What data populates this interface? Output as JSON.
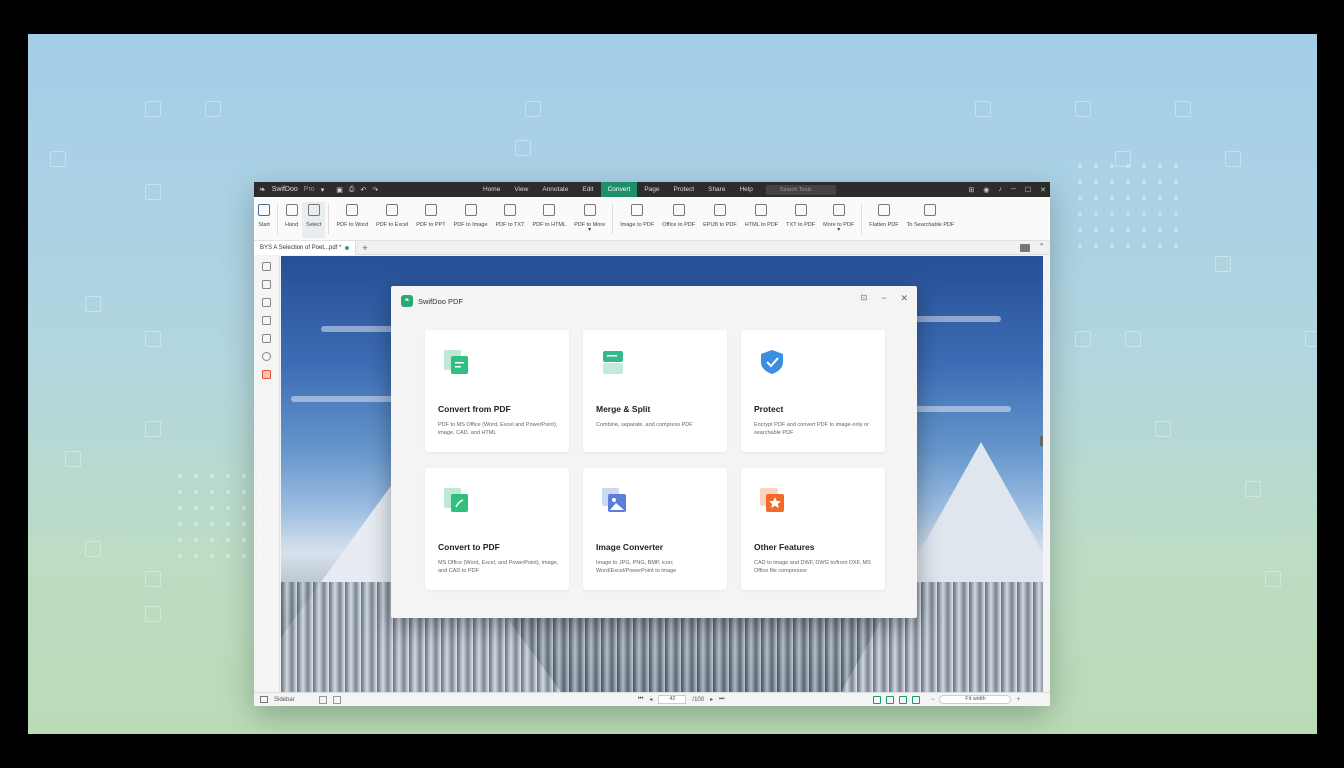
{
  "app": {
    "name": "SwifDoo",
    "edition": "Pro",
    "menu": [
      "Home",
      "View",
      "Annotate",
      "Edit",
      "Convert",
      "Page",
      "Protect",
      "Share",
      "Help"
    ],
    "active_menu": "Convert",
    "search_placeholder": "Search Tools"
  },
  "ribbon": {
    "start": "Start",
    "hand": "Hand",
    "select": "Select",
    "from_pdf": [
      "PDF to Word",
      "PDF to Excel",
      "PDF to PPT",
      "PDF to Image",
      "PDF to TXT",
      "PDF to HTML",
      "PDF to More"
    ],
    "to_pdf": [
      "Image to PDF",
      "Office to PDF",
      "EPUB to PDF",
      "HTML to PDF",
      "TXT to PDF",
      "More to PDF"
    ],
    "tools": [
      "Flatten PDF",
      "To Searchable PDF"
    ]
  },
  "document_tab": {
    "title": "BYS A Selection of Poet...pdf *"
  },
  "statusbar": {
    "sidebar_label": "Sidebar",
    "page_current": "42",
    "page_total": "/100",
    "zoom": "Fit width"
  },
  "dialog": {
    "title": "SwifDoo PDF",
    "cards": [
      {
        "title": "Convert from PDF",
        "desc": "PDF to MS Office (Word, Excel and PowerPoint), image, CAD, and HTML",
        "icon": "convert-from-pdf-icon",
        "color": "#2fbf7f"
      },
      {
        "title": "Merge & Split",
        "desc": "Combine, separate, and compress PDF",
        "icon": "merge-split-icon",
        "color": "#35b98b"
      },
      {
        "title": "Protect",
        "desc": "Encrypt PDF and convert PDF to image-only or searchable PDF",
        "icon": "protect-shield-icon",
        "color": "#3a8fe0"
      },
      {
        "title": "Convert to PDF",
        "desc": "MS Office (Word, Excel, and PowerPoint), image, and CAD to PDF",
        "icon": "convert-to-pdf-icon",
        "color": "#2fbf7f"
      },
      {
        "title": "Image Converter",
        "desc": "Image to JPG, PNG, BMP, icon; Word/Excel/PowerPoint to image",
        "icon": "image-converter-icon",
        "color": "#5b7fd6"
      },
      {
        "title": "Other Features",
        "desc": "CAD to image and DWF, DWG to/from DXF, MS Office file compressor",
        "icon": "other-features-icon",
        "color": "#f06a2b"
      }
    ]
  }
}
